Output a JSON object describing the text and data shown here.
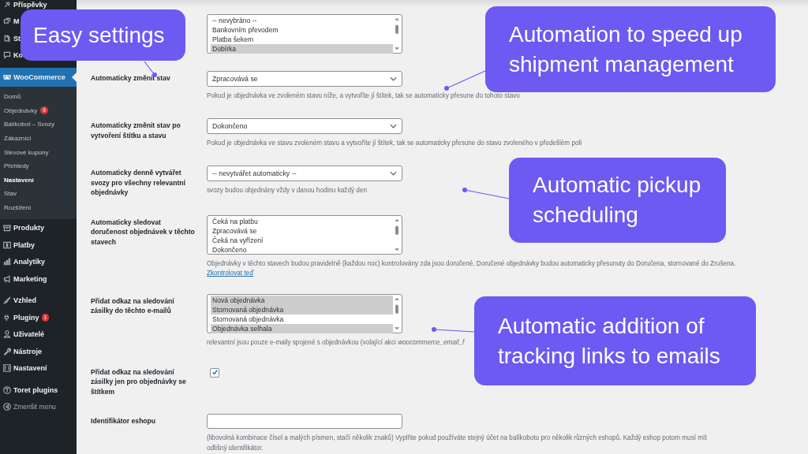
{
  "sidebar": {
    "groups": [
      [
        {
          "label": "Příspěvky",
          "selected": false,
          "kind": "menu"
        },
        {
          "label": "M",
          "selected": false,
          "kind": "menu"
        },
        {
          "label": "St",
          "selected": false,
          "kind": "menu"
        },
        {
          "label": "Ko",
          "selected": false,
          "kind": "menu"
        }
      ],
      [
        {
          "label": "WooCommerce",
          "selected": true,
          "kind": "menu",
          "children": [
            {
              "label": "Domů",
              "selected": false
            },
            {
              "label": "Objednávky",
              "selected": false,
              "badge": "9"
            },
            {
              "label": "Balíkobot – Svozy",
              "selected": false
            },
            {
              "label": "Zákazníci",
              "selected": false
            },
            {
              "label": "Slevové kupony",
              "selected": false
            },
            {
              "label": "Přehledy",
              "selected": false
            },
            {
              "label": "Nastavení",
              "selected": true
            },
            {
              "label": "Stav",
              "selected": false
            },
            {
              "label": "Rozšíření",
              "selected": false
            }
          ]
        },
        {
          "label": "Produkty",
          "selected": false,
          "kind": "menu"
        },
        {
          "label": "Platby",
          "selected": false,
          "kind": "menu"
        },
        {
          "label": "Analytiky",
          "selected": false,
          "kind": "menu"
        },
        {
          "label": "Marketing",
          "selected": false,
          "kind": "menu"
        }
      ],
      [
        {
          "label": "Vzhled",
          "selected": false,
          "kind": "menu"
        },
        {
          "label": "Pluginy",
          "selected": false,
          "kind": "menu",
          "badge": "1"
        },
        {
          "label": "Uživatelé",
          "selected": false,
          "kind": "menu"
        },
        {
          "label": "Nástroje",
          "selected": false,
          "kind": "menu"
        },
        {
          "label": "Nastavení",
          "selected": false,
          "kind": "menu"
        }
      ],
      [
        {
          "label": "Toret plugins",
          "selected": false,
          "kind": "menu"
        },
        {
          "label": "Zmenšit menu",
          "selected": false,
          "kind": "collapse"
        }
      ]
    ]
  },
  "settings": [
    {
      "kind": "listbox",
      "options": [
        {
          "text": "-- nevybráno --",
          "selected": false
        },
        {
          "text": "Bankovním převodem",
          "selected": false
        },
        {
          "text": "Platba šekem",
          "selected": false
        },
        {
          "text": "Dobírka",
          "selected": true
        }
      ]
    },
    {
      "kind": "select",
      "label": "Automaticky změnit stav",
      "value": "Zpracovává se",
      "description": "Pokud je objednávka ve zvoleném stavu níže, a vytvoříte jí štítek, tak se automaticky přesune do tohoto stavu"
    },
    {
      "kind": "select",
      "label": "Automaticky změnit stav po vytvoření štítku a stavu",
      "value": "Dokončeno",
      "description": "Pokud je objednávka ve stavu zvoleném stavu a vytvoříte jí štítek, tak se automaticky přesune do stavu zvoleného v předešlém poli"
    },
    {
      "kind": "select",
      "label": "Automaticky denně vytvářet svozy pro všechny relevantní objednávky",
      "value": "-- nevytvářet automaticky --",
      "description": "svozy budou objednány vždy v danou hodinu každý den"
    },
    {
      "kind": "listbox",
      "label": "Automaticky sledovat doručenost objednávek v těchto stavech",
      "options": [
        {
          "text": "Čeká na platbu",
          "selected": false
        },
        {
          "text": "Zpracovává se",
          "selected": false
        },
        {
          "text": "Čeká na vyřízení",
          "selected": false
        },
        {
          "text": "Dokončeno",
          "selected": false
        }
      ],
      "description": "Objednávky v těchto stavech budou pravidelně (každou noc) kontrolovány zda jsou doručené. Doručené objednávky budou automaticky přesunuty do Doručena, stornované do Zrušena.",
      "link": "Zkontrolovat teď"
    },
    {
      "kind": "listbox",
      "label": "Přidat odkaz na sledování zásilky do těchto e-mailů",
      "options": [
        {
          "text": "Nová objednávka",
          "selected": true
        },
        {
          "text": "Stornovaná objednávka",
          "selected": true
        },
        {
          "text": "Stornovaná objednávka",
          "selected": false
        },
        {
          "text": "Objednávka selhala",
          "selected": true
        }
      ],
      "description": "relevantní jsou pouze e-maily spojené s objednávkou (volající akci *woocommerce_email_f*"
    },
    {
      "kind": "checkbox",
      "label": "Přidat odkaz na sledování zásilky jen pro objednávky se štítkem",
      "checked": true
    },
    {
      "kind": "text",
      "label": "Identifikátor eshopu",
      "description": "(libovolná kombinace čísel a malých písmen, stačí několik znaků) Vyplňte pokud používáte stejný účet na balíkobotu pro několik různých eshopů. Každý eshop potom musí mít odlišný identifikátor."
    }
  ],
  "callouts": [
    {
      "text": "Easy settings"
    },
    {
      "text": "Automation to speed up shipment management"
    },
    {
      "text": "Automatic pickup scheduling"
    },
    {
      "text": "Automatic addition of tracking links to emails"
    }
  ]
}
